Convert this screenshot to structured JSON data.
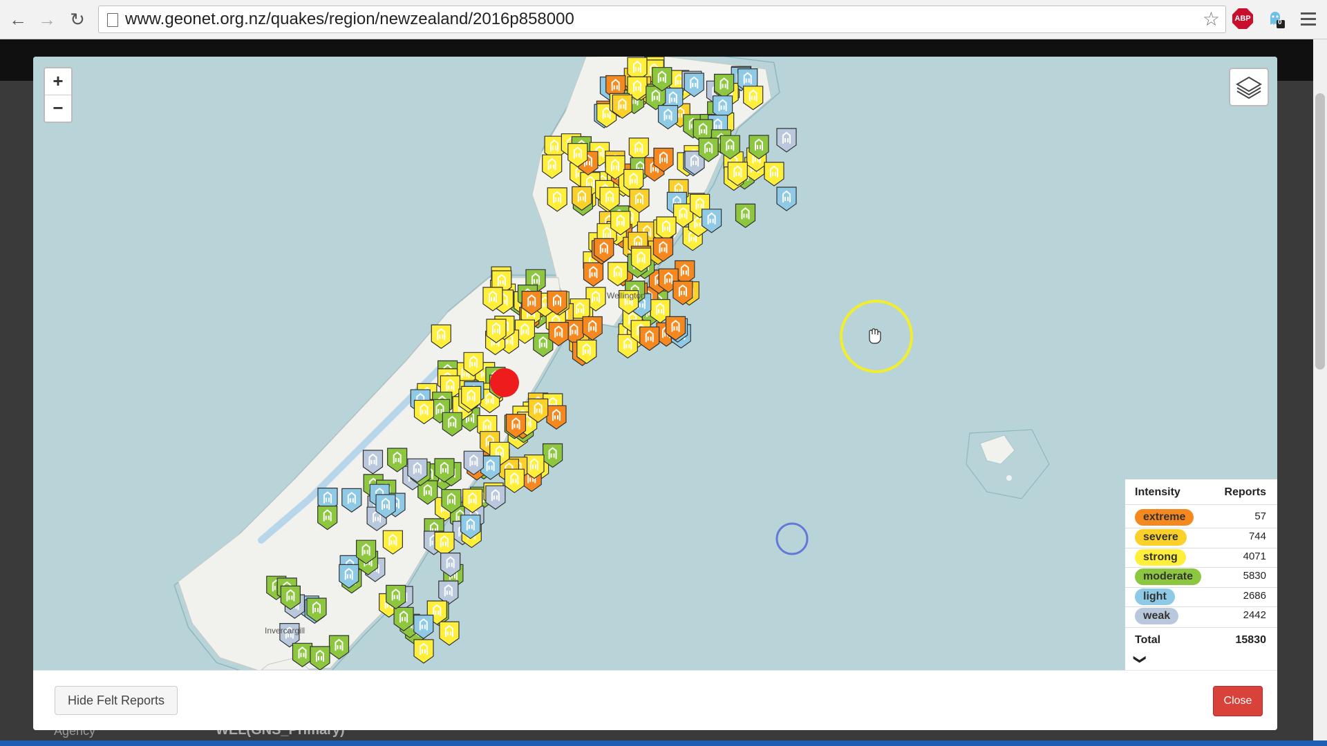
{
  "browser": {
    "url": "www.geonet.org.nz/quakes/region/newzealand/2016p858000",
    "abp_label": "ABP",
    "ghost_badge": "0"
  },
  "map": {
    "zoom_in": "+",
    "zoom_out": "−",
    "place_labels": [
      "Wellington",
      "Invercargill"
    ]
  },
  "legend": {
    "intensity_header": "Intensity",
    "reports_header": "Reports",
    "rows": [
      {
        "label": "extreme",
        "value": "57",
        "color": "#f5891f"
      },
      {
        "label": "severe",
        "value": "744",
        "color": "#fbd129"
      },
      {
        "label": "strong",
        "value": "4071",
        "color": "#ffef3b"
      },
      {
        "label": "moderate",
        "value": "5830",
        "color": "#8dc63f"
      },
      {
        "label": "light",
        "value": "2686",
        "color": "#8ecae6"
      },
      {
        "label": "weak",
        "value": "2442",
        "color": "#b9c8dd"
      }
    ],
    "total_label": "Total",
    "total_value": "15830"
  },
  "footer": {
    "hide_label": "Hide Felt Reports",
    "close_label": "Close"
  },
  "page": {
    "bg_text_1": "Agency",
    "bg_text_2": "WEL(GNS_Primary)"
  }
}
